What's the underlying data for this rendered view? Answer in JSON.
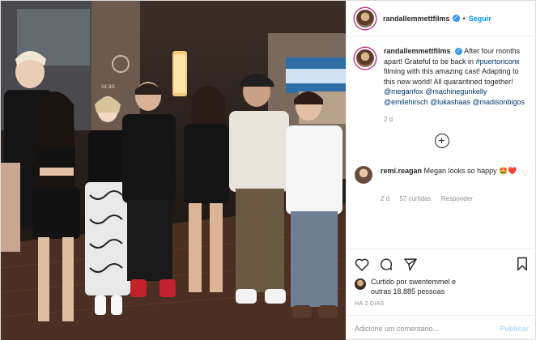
{
  "post": {
    "username": "randallemmettfilms",
    "follow_label": "Seguir",
    "caption_text": "After four months apart! Grateful to be back in",
    "caption_tag": "#puertoricoпк",
    "caption_rest": "filming with this amazing cast! Adapting to this new world! All quarantined together!",
    "mentions": [
      "@meganfox",
      "@machinegunkelly",
      "@emilehirsch",
      "@lukashaas",
      "@madisonbigos"
    ],
    "caption_age": "2 d",
    "photo_sign": "ucan"
  },
  "comment": {
    "username": "remi.reagan",
    "text": "Megan looks so happy",
    "emoji": "🤩❤️",
    "age": "2 d",
    "likes": "57 curtidas",
    "reply_label": "Responder"
  },
  "likes": {
    "line1": "Curtido por swentemmel e",
    "line2": "outras 18.885 pessoas",
    "liked_by_user": "swentemmel"
  },
  "date_label": "HÁ 2 DIAS",
  "add_comment": {
    "placeholder": "Adicione um comentário...",
    "publish_label": "Publicar"
  },
  "colors": {
    "link": "#0095f6",
    "tag": "#00376b",
    "muted": "#8e8e8e",
    "verified": "#3897f0"
  },
  "icons": [
    "verified-badge-icon",
    "plus-circle-icon",
    "heart-icon",
    "comment-icon",
    "share-icon",
    "bookmark-icon"
  ]
}
